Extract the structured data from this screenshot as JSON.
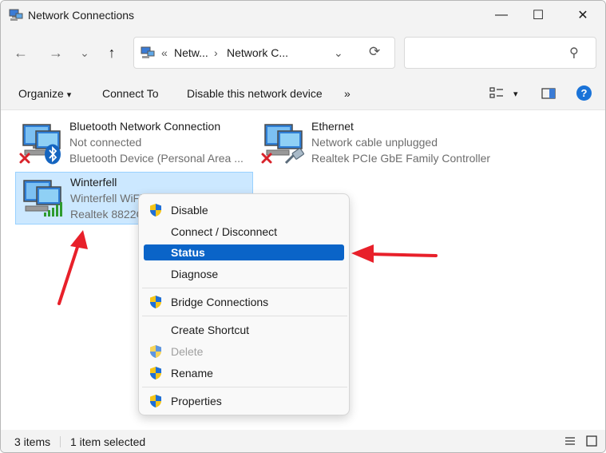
{
  "window": {
    "title": "Network Connections"
  },
  "titlebar": {
    "minimize": "—",
    "maximize": "☐",
    "close": "✕"
  },
  "nav": {
    "back": "←",
    "forward": "→",
    "recent": "⌄",
    "up": "↑",
    "overflow": "«",
    "crumbs": [
      "Netw...",
      "Network C..."
    ],
    "sep": "›",
    "dropdown": "⌄",
    "refresh": "⟳",
    "search_placeholder": "",
    "search_icon": "⚲"
  },
  "commands": {
    "organize": "Organize",
    "organize_caret": "▾",
    "connect_to": "Connect To",
    "disable_device": "Disable this network device",
    "more": "»",
    "view_caret": "▾",
    "help": "?"
  },
  "connections": [
    {
      "name": "Bluetooth Network Connection",
      "status": "Not connected",
      "device": "Bluetooth Device (Personal Area ..."
    },
    {
      "name": "Ethernet",
      "status": "Network cable unplugged",
      "device": "Realtek PCIe GbE Family Controller"
    },
    {
      "name": "Winterfell",
      "status": "Winterfell WiFi",
      "device": "Realtek 8822C"
    }
  ],
  "context_menu": {
    "items": [
      {
        "label": "Disable",
        "shield": true
      },
      {
        "label": "Connect / Disconnect",
        "shield": false
      },
      {
        "label": "Status",
        "shield": false,
        "highlighted": true
      },
      {
        "label": "Diagnose",
        "shield": false
      },
      {
        "label": "Bridge Connections",
        "shield": true
      },
      {
        "label": "Create Shortcut",
        "shield": false
      },
      {
        "label": "Delete",
        "shield": true,
        "disabled": true
      },
      {
        "label": "Rename",
        "shield": true
      },
      {
        "label": "Properties",
        "shield": true
      }
    ]
  },
  "status_bar": {
    "items_count": "3 items",
    "selected": "1 item selected"
  },
  "colors": {
    "accent": "#0a64c8",
    "selection": "#cce8ff",
    "annotation_arrow": "#e8202a"
  }
}
